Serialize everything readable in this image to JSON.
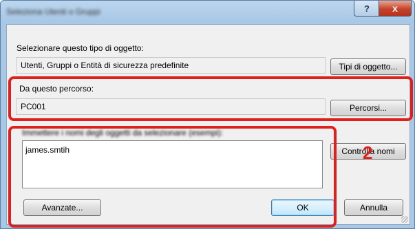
{
  "window": {
    "title": "Seleziona Utenti o Gruppi",
    "help_label": "?",
    "close_label": "x"
  },
  "object_type": {
    "label": "Selezionare questo tipo di oggetto:",
    "value": "Utenti, Gruppi o Entità di sicurezza predefinite",
    "button": "Tipi di oggetto..."
  },
  "location": {
    "label": "Da questo percorso:",
    "value": "PC001",
    "button": "Percorsi..."
  },
  "names": {
    "label": "Immettere i nomi degli oggetti da selezionare (esempi):",
    "value": "james.smtih",
    "check_button": "Controlla nomi"
  },
  "footer": {
    "advanced_button": "Avanzate...",
    "ok_button": "OK",
    "cancel_button": "Annulla"
  },
  "annotation": {
    "callout_number": "2",
    "highlight_color": "#e0201b"
  }
}
